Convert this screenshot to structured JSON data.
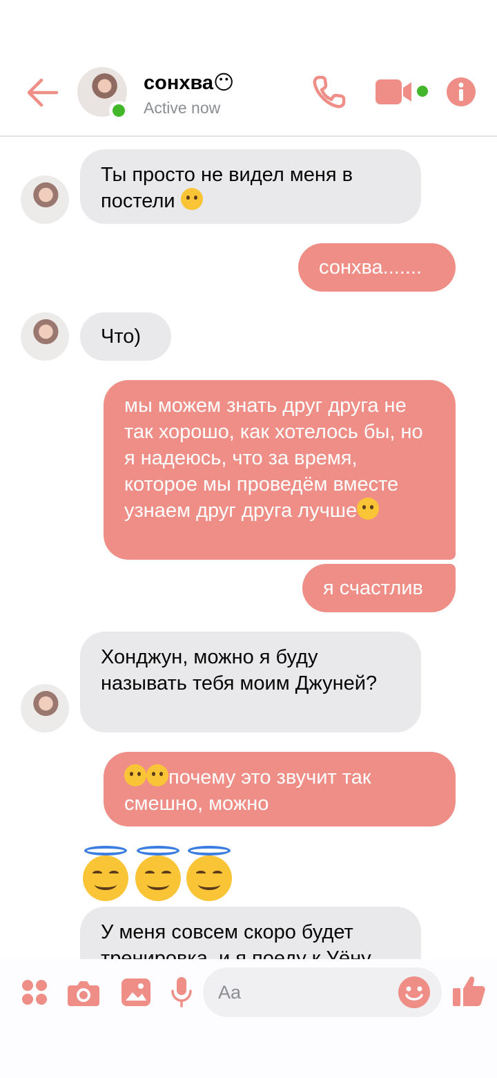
{
  "header": {
    "contact_name": "сонхва😶",
    "status": "Active now",
    "icons": [
      "back-arrow-icon",
      "phone-icon",
      "video-camera-icon",
      "info-icon"
    ]
  },
  "colors": {
    "accent": "#ee8e86",
    "incoming_bubble": "#e9e9eb",
    "online": "#42b72a"
  },
  "messages": [
    {
      "direction": "in",
      "text": "Ты просто не видел меня в постели",
      "emoji": "😚"
    },
    {
      "direction": "out",
      "text": "сонхва......."
    },
    {
      "direction": "in",
      "text": "Что)"
    },
    {
      "direction": "out",
      "text": "мы можем знать друг друга не так хорошо, как хотелось бы, но я надеюсь, что за время, которое мы проведём вместе узнаем друг друга лучше",
      "emoji": "🥺"
    },
    {
      "direction": "out",
      "text": "я счастлив"
    },
    {
      "direction": "in",
      "text": "Хонджун, можно я буду называть тебя моим Джуней?"
    },
    {
      "direction": "out",
      "text": "почему это звучит так смешно, можно",
      "emoji_prefix": "🤭🤭"
    },
    {
      "direction": "in",
      "text": "😇😇😇",
      "type": "large-emoji"
    },
    {
      "direction": "in",
      "text": "У меня совсем скоро будет тренировка, и я поеду к Уёну"
    }
  ],
  "composer": {
    "placeholder": "Aa",
    "icons": [
      "apps-icon",
      "camera-icon",
      "gallery-icon",
      "microphone-icon",
      "emoji-icon",
      "thumbs-up-icon"
    ]
  }
}
